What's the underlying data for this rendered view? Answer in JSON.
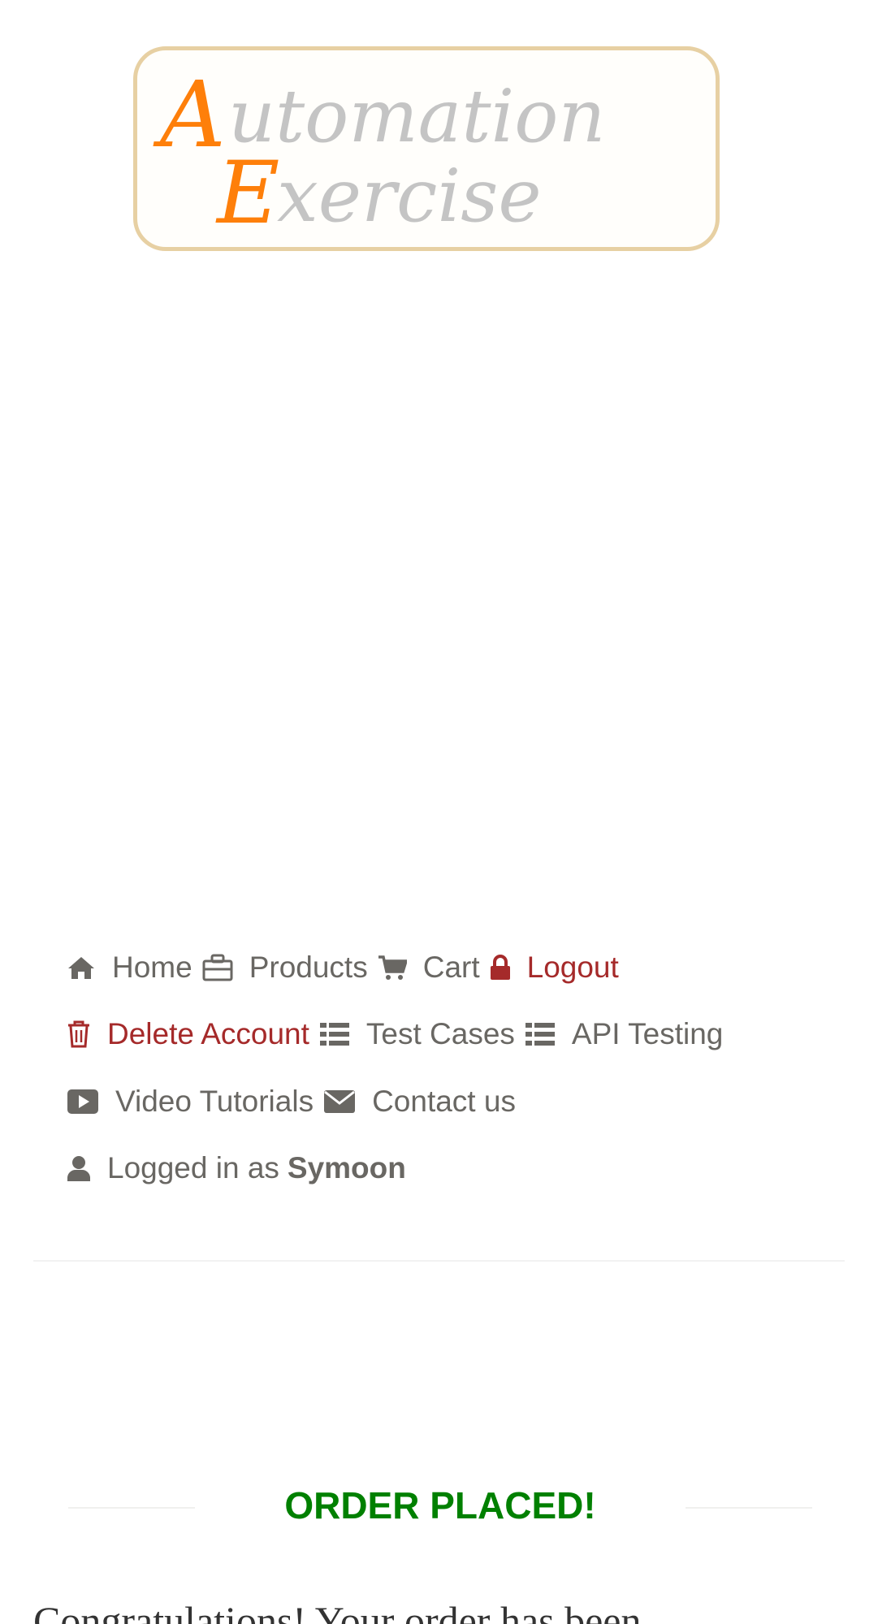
{
  "logo": {
    "line1_initial": "A",
    "line1_rest": "utomation",
    "line2_initial": "E",
    "line2_rest": "xercise"
  },
  "nav": {
    "home": "Home",
    "products": "Products",
    "cart": "Cart",
    "logout": "Logout",
    "delete_account": "Delete Account",
    "test_cases": "Test Cases",
    "api_testing": "API Testing",
    "video_tutorials": "Video Tutorials",
    "contact_us": "Contact us",
    "logged_in_prefix": "Logged in as",
    "username": "Symoon"
  },
  "order": {
    "title": "ORDER PLACED!",
    "message": "Congratulations! Your order has been"
  },
  "colors": {
    "accent_orange": "#fe980f",
    "logo_grey": "#c0c0c0",
    "nav_text": "#696763",
    "nav_danger": "#a52a2a",
    "success_green": "#008000"
  },
  "icons": {
    "home": "home-icon",
    "products": "briefcase-icon",
    "cart": "shopping-cart-icon",
    "logout": "lock-icon",
    "delete_account": "trash-icon",
    "test_cases": "list-icon",
    "api_testing": "list-icon",
    "video_tutorials": "youtube-play-icon",
    "contact_us": "envelope-icon",
    "logged_in": "user-icon"
  }
}
